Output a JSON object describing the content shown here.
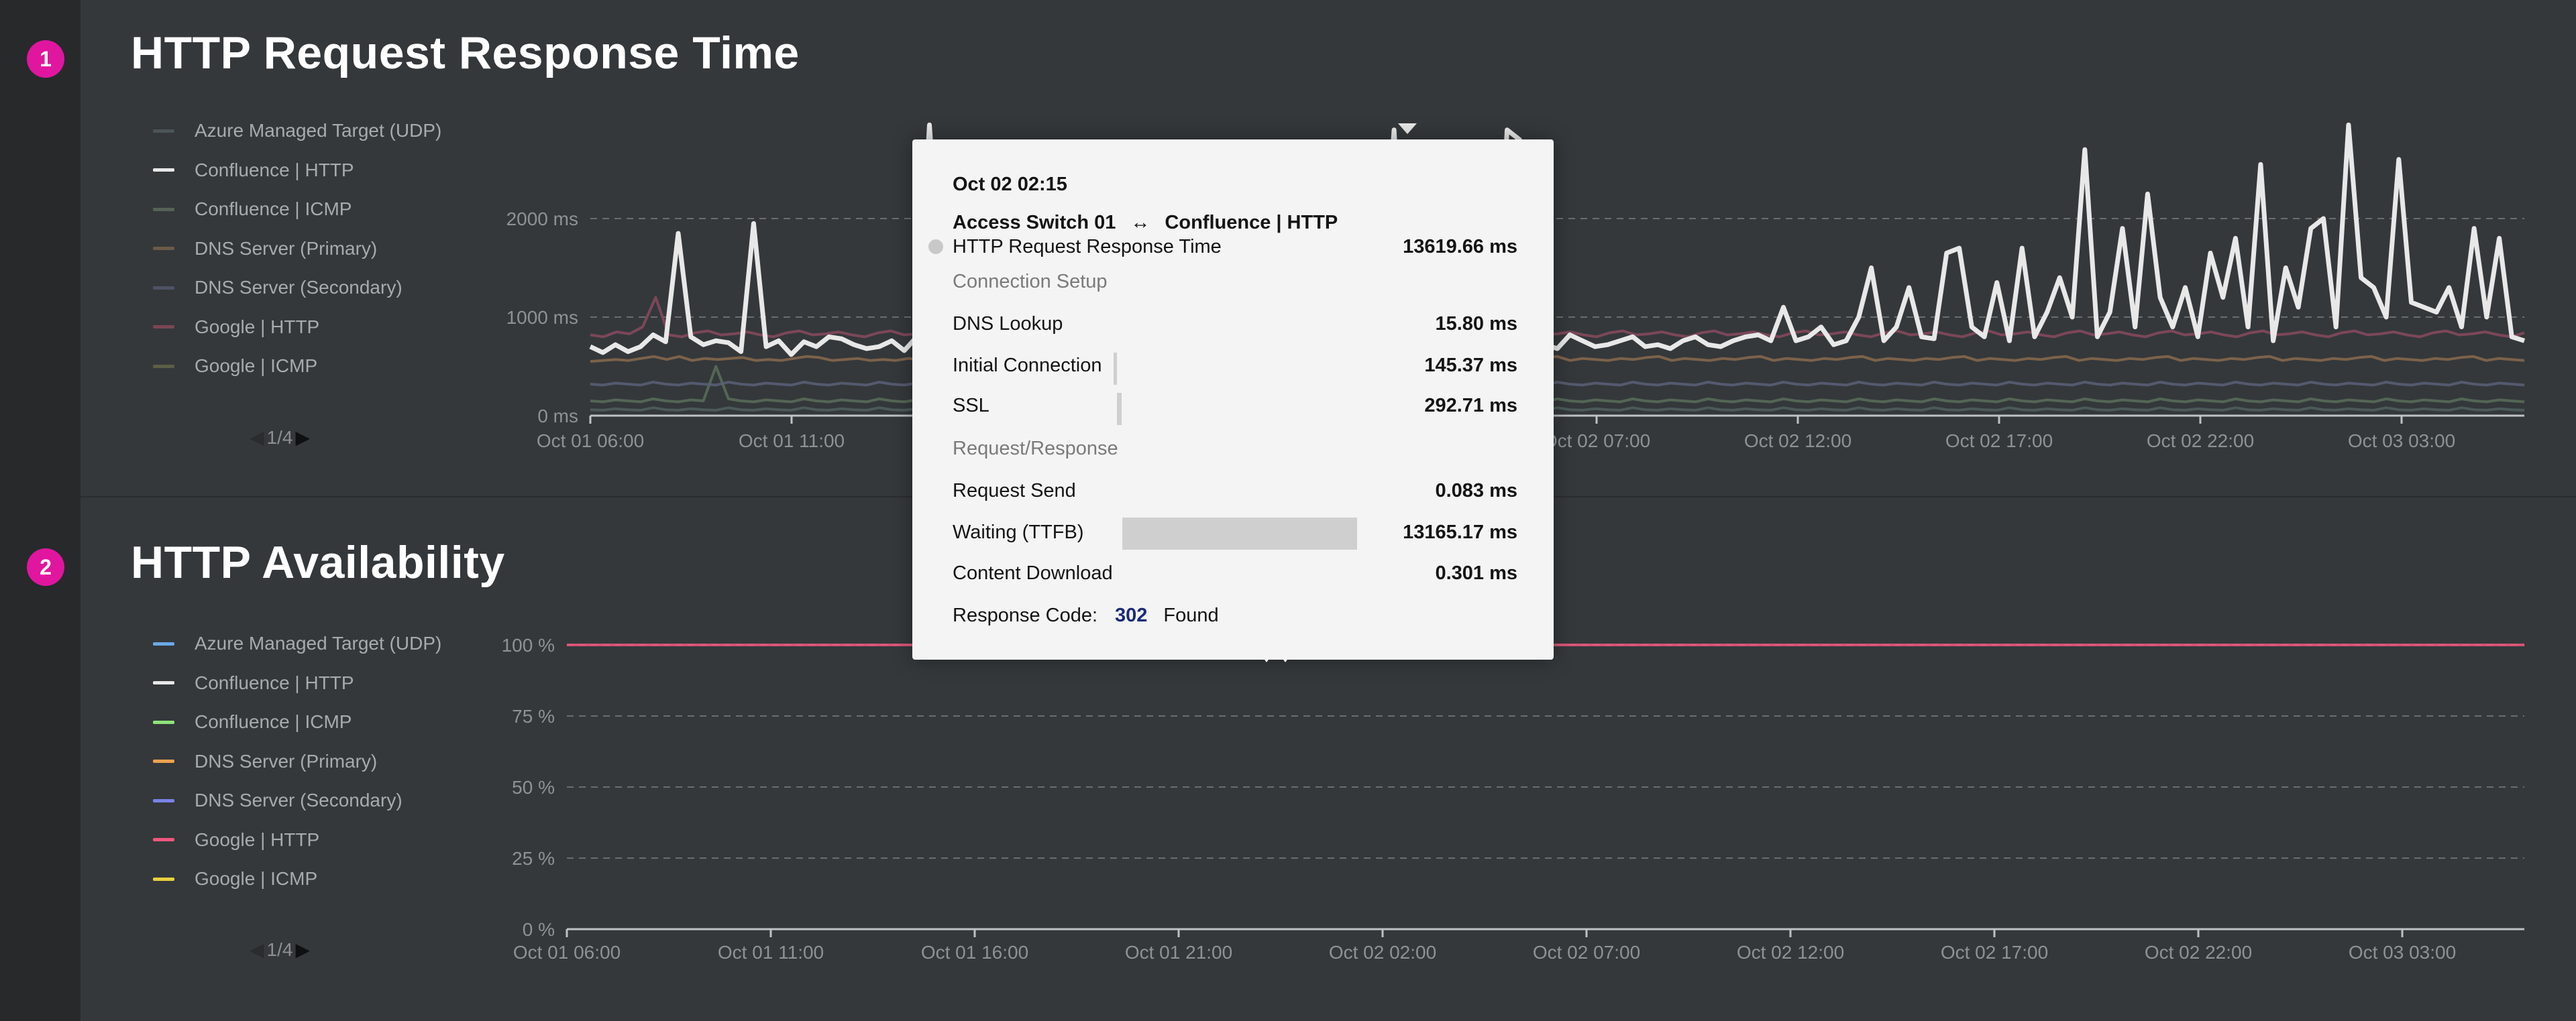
{
  "panels": [
    {
      "number": "1",
      "title": "HTTP Request Response Time"
    },
    {
      "number": "2",
      "title": "HTTP Availability"
    }
  ],
  "legend1": [
    {
      "label": "Azure Managed Target (UDP)",
      "color": "#4b5559"
    },
    {
      "label": "Confluence | HTTP",
      "color": "#e8e8e8"
    },
    {
      "label": "Confluence | ICMP",
      "color": "#566256"
    },
    {
      "label": "DNS Server (Primary)",
      "color": "#6b5a47"
    },
    {
      "label": "DNS Server (Secondary)",
      "color": "#4d5266"
    },
    {
      "label": "Google | HTTP",
      "color": "#7a4654"
    },
    {
      "label": "Google | ICMP",
      "color": "#5c5e45"
    }
  ],
  "legend2": [
    {
      "label": "Azure Managed Target (UDP)",
      "color": "#6aa8e8"
    },
    {
      "label": "Confluence | HTTP",
      "color": "#e8e8e8"
    },
    {
      "label": "Confluence | ICMP",
      "color": "#8fe37a"
    },
    {
      "label": "DNS Server (Primary)",
      "color": "#f0a050"
    },
    {
      "label": "DNS Server (Secondary)",
      "color": "#7a82e8"
    },
    {
      "label": "Google | HTTP",
      "color": "#f2577f"
    },
    {
      "label": "Google | ICMP",
      "color": "#e8d040"
    }
  ],
  "pager1": "1/4",
  "pager2": "1/4",
  "chart_data": [
    {
      "type": "line",
      "title": "HTTP Request Response Time",
      "ylim": [
        0,
        2000
      ],
      "yticks": [
        "0 ms",
        "1000 ms",
        "2000 ms"
      ],
      "xticks": [
        "Oct 01 06:00",
        "Oct 01 11:00",
        "Oct 01 16:00",
        "Oct 01 21:00",
        "Oct 02 02:00",
        "Oct 02 07:00",
        "Oct 02 12:00",
        "Oct 02 17:00",
        "Oct 02 22:00",
        "Oct 03 03:00"
      ],
      "grid": true,
      "series": [
        {
          "name": "Confluence | HTTP",
          "color": "#e8e8e8",
          "values": [
            700,
            640,
            720,
            650,
            700,
            820,
            750,
            1850,
            800,
            720,
            760,
            740,
            650,
            1950,
            700,
            760,
            620,
            750,
            700,
            800,
            780,
            720,
            680,
            700,
            760,
            660,
            800,
            2950,
            1150,
            720,
            680,
            700,
            1600,
            720,
            760,
            680,
            800,
            720,
            660,
            1500,
            760,
            720,
            2600,
            800,
            700,
            900,
            760,
            1500,
            720,
            680,
            700,
            760,
            820,
            1600,
            700,
            900,
            720,
            820,
            1300,
            760,
            680,
            700,
            2400,
            1200,
            2900,
            780,
            720,
            2300,
            2450,
            1400,
            700,
            760,
            720,
            2900,
            2800,
            800,
            720,
            680,
            820,
            760,
            700,
            720,
            760,
            800,
            700,
            720,
            680,
            760,
            800,
            720,
            700,
            760,
            800,
            820,
            760,
            1100,
            760,
            800,
            900,
            720,
            760,
            1000,
            1500,
            760,
            900,
            1300,
            800,
            780,
            1650,
            1700,
            900,
            800,
            1350,
            760,
            1700,
            800,
            1050,
            1400,
            1000,
            2700,
            800,
            1050,
            1900,
            900,
            2250,
            1200,
            900,
            1300,
            800,
            1650,
            1200,
            1800,
            900,
            2550,
            760,
            1500,
            1100,
            1900,
            2000,
            900,
            2950,
            1400,
            1300,
            1000,
            2600,
            1150,
            1100,
            1050,
            1300,
            900,
            1900,
            1000,
            1800,
            800,
            760
          ]
        },
        {
          "name": "DNS Server (Primary)",
          "color": "#8a6a4e",
          "values": [
            550,
            560,
            570,
            560,
            580,
            600,
            570,
            600,
            560,
            580,
            570,
            580,
            590,
            560,
            570,
            560,
            580,
            600,
            590,
            560,
            570,
            580,
            560,
            570,
            560,
            580,
            570,
            590,
            600,
            560,
            580,
            570,
            560,
            580,
            590,
            570,
            580,
            560,
            570,
            580,
            590,
            600,
            560,
            570,
            580,
            560,
            570,
            590,
            600,
            560,
            580,
            570,
            560,
            580,
            570,
            590,
            600,
            560,
            580,
            570,
            560,
            570,
            580,
            600,
            560,
            580,
            570,
            560,
            590,
            600,
            560,
            570,
            580,
            560,
            570,
            590,
            600,
            560,
            580,
            570,
            560,
            580,
            570,
            590,
            600,
            560,
            580,
            570,
            560,
            580,
            570,
            590,
            600,
            560,
            580,
            570,
            560,
            580,
            570,
            590,
            600,
            560,
            580,
            570,
            560,
            580,
            570,
            590,
            600,
            560,
            580,
            570,
            560,
            580,
            570,
            590,
            600,
            560,
            580,
            570,
            560,
            580,
            570,
            590,
            600,
            560,
            580,
            570,
            560,
            580,
            570,
            590,
            600,
            560,
            580,
            570,
            560,
            580,
            570,
            590,
            600,
            560,
            580,
            570,
            560,
            580,
            570,
            590,
            600,
            560,
            580,
            570,
            560
          ]
        },
        {
          "name": "Google | HTTP",
          "color": "#8a4a5e",
          "values": [
            820,
            800,
            850,
            830,
            900,
            1200,
            820,
            800,
            840,
            860,
            820,
            830,
            850,
            820,
            800,
            840,
            860,
            820,
            830,
            850,
            820,
            800,
            840,
            860,
            820,
            830,
            850,
            820,
            800,
            840,
            860,
            820,
            830,
            850,
            820,
            800,
            840,
            860,
            820,
            830,
            850,
            820,
            800,
            840,
            860,
            820,
            830,
            850,
            820,
            800,
            840,
            860,
            820,
            830,
            850,
            820,
            800,
            840,
            860,
            820,
            830,
            850,
            820,
            800,
            840,
            860,
            820,
            830,
            850,
            820,
            800,
            840,
            860,
            820,
            830,
            850,
            820,
            800,
            840,
            860,
            820,
            830,
            850,
            820,
            800,
            840,
            860,
            820,
            830,
            850,
            820,
            800,
            840,
            860,
            820,
            830,
            850,
            820,
            800,
            840,
            860,
            820,
            830,
            850,
            820,
            800,
            840,
            860,
            820,
            830,
            850,
            820,
            800,
            840,
            860,
            820,
            830,
            850,
            820,
            800,
            840,
            860,
            820,
            830,
            850,
            820,
            800,
            840,
            860,
            820,
            830,
            850,
            820,
            800,
            840,
            860,
            820,
            830,
            850,
            820,
            800,
            840,
            860,
            820,
            830,
            850,
            820,
            800,
            840
          ]
        },
        {
          "name": "DNS Server (Secondary)",
          "color": "#5a6078",
          "values": [
            320,
            310,
            330,
            320,
            310,
            340,
            320,
            310,
            330,
            320,
            310,
            340,
            320,
            310,
            330,
            320,
            310,
            340,
            320,
            310,
            330,
            320,
            310,
            340,
            320,
            310,
            330,
            320,
            310,
            340,
            320,
            310,
            330,
            320,
            310,
            340,
            320,
            310,
            330,
            320,
            310,
            340,
            320,
            310,
            330,
            320,
            310,
            340,
            320,
            310,
            330,
            320,
            310,
            340,
            320,
            310,
            330,
            320,
            310,
            340,
            320,
            310,
            330,
            320,
            310,
            340,
            320,
            310,
            330,
            320,
            310,
            340,
            320,
            310,
            330,
            320,
            310,
            340,
            320,
            310,
            330,
            320,
            310,
            340,
            320,
            310,
            330,
            320,
            310,
            340,
            320,
            310,
            330,
            320,
            310,
            340,
            320,
            310,
            330,
            320,
            310,
            340,
            320,
            310,
            330,
            320,
            310,
            340,
            320,
            310,
            330,
            320,
            310,
            340,
            320,
            310,
            330,
            320,
            310,
            340,
            320,
            310,
            330,
            320,
            310,
            340,
            320,
            310,
            330,
            320,
            310,
            340,
            320,
            310,
            330,
            320,
            310,
            340,
            320,
            310,
            330,
            320,
            310,
            340,
            320,
            310,
            330,
            320,
            310,
            340,
            320,
            310,
            330,
            320,
            310
          ]
        },
        {
          "name": "Confluence | ICMP",
          "color": "#5a6e5a",
          "values": [
            150,
            140,
            160,
            150,
            140,
            170,
            150,
            140,
            160,
            150,
            500,
            170,
            150,
            140,
            160,
            150,
            140,
            170,
            150,
            140,
            160,
            150,
            140,
            170,
            150,
            140,
            160,
            150,
            140,
            170,
            150,
            140,
            160,
            150,
            140,
            170,
            150,
            140,
            160,
            150,
            140,
            170,
            150,
            140,
            160,
            150,
            140,
            170,
            150,
            140,
            160,
            150,
            140,
            170,
            150,
            140,
            160,
            150,
            140,
            170,
            150,
            140,
            160,
            150,
            140,
            170,
            150,
            140,
            160,
            150,
            140,
            170,
            150,
            140,
            160,
            150,
            140,
            170,
            150,
            140,
            160,
            150,
            140,
            170,
            150,
            140,
            160,
            150,
            140,
            170,
            150,
            140,
            160,
            150,
            140,
            170,
            150,
            140,
            160,
            150,
            140,
            170,
            150,
            140,
            160,
            150,
            140,
            170,
            150,
            140,
            160,
            150,
            140,
            170,
            150,
            140,
            160,
            150,
            140,
            170,
            150,
            140,
            160,
            150,
            140,
            170,
            150,
            140,
            160,
            150,
            140,
            170,
            150,
            140,
            160,
            150,
            140,
            170,
            150,
            140,
            160,
            150,
            140,
            170,
            150,
            140,
            160,
            150,
            140,
            170,
            150,
            140,
            160,
            150,
            140
          ]
        },
        {
          "name": "Azure Managed Target (UDP)",
          "color": "#50605e",
          "values": [
            60,
            55,
            70,
            60,
            55,
            80,
            60,
            55,
            70,
            60,
            55,
            80,
            60,
            55,
            70,
            60,
            55,
            80,
            60,
            55,
            70,
            60,
            55,
            80,
            60,
            55,
            70,
            60,
            55,
            80,
            60,
            55,
            70,
            60,
            55,
            80,
            60,
            55,
            70,
            60,
            55,
            80,
            60,
            55,
            70,
            60,
            55,
            80,
            60,
            55,
            70,
            60,
            55,
            80,
            60,
            55,
            70,
            60,
            55,
            80,
            60,
            55,
            70,
            60,
            55,
            80,
            60,
            55,
            70,
            60,
            55,
            80,
            60,
            55,
            70,
            60,
            55,
            80,
            60,
            55,
            70,
            60,
            55,
            80,
            60,
            55,
            70,
            60,
            55,
            80,
            60,
            55,
            70,
            60,
            55,
            80,
            60,
            55,
            70,
            60,
            55,
            80,
            60,
            55,
            70,
            60,
            55,
            80,
            60,
            55,
            70,
            60,
            55,
            80,
            60,
            55,
            70,
            60,
            55,
            80,
            60,
            55,
            70,
            60,
            55,
            80,
            60,
            55,
            70,
            60,
            55,
            80,
            60,
            55,
            70,
            60,
            55,
            80,
            60,
            55,
            70,
            60,
            55,
            80,
            60,
            55,
            70,
            60,
            55,
            80,
            60,
            55,
            70,
            60,
            55
          ]
        }
      ]
    },
    {
      "type": "line",
      "title": "HTTP Availability",
      "ylim": [
        0,
        100
      ],
      "yticks": [
        "0 %",
        "25 %",
        "50 %",
        "75 %",
        "100 %"
      ],
      "xticks": [
        "Oct 01 06:00",
        "Oct 01 11:00",
        "Oct 01 16:00",
        "Oct 01 21:00",
        "Oct 02 02:00",
        "Oct 02 07:00",
        "Oct 02 12:00",
        "Oct 02 17:00",
        "Oct 02 22:00",
        "Oct 03 03:00"
      ],
      "grid": true,
      "series": [
        {
          "name": "Google | HTTP",
          "color": "#f2577f",
          "values": [
            100,
            100
          ]
        }
      ]
    }
  ],
  "tooltip": {
    "time": "Oct 02 02:15",
    "source": "Access Switch 01",
    "arrow": "↔",
    "target": "Confluence | HTTP",
    "metric_label": "HTTP Request Response Time",
    "metric_value": "13619.66 ms",
    "section1": "Connection Setup",
    "dns_label": "DNS Lookup",
    "dns_value": "15.80 ms",
    "init_label": "Initial Connection",
    "init_value": "145.37 ms",
    "ssl_label": "SSL",
    "ssl_value": "292.71 ms",
    "section2": "Request/Response",
    "send_label": "Request Send",
    "send_value": "0.083 ms",
    "wait_label": "Waiting (TTFB)",
    "wait_value": "13165.17 ms",
    "download_label": "Content Download",
    "download_value": "0.301 ms",
    "code_label": "Response Code:",
    "code_value": "302",
    "code_text": "Found"
  }
}
